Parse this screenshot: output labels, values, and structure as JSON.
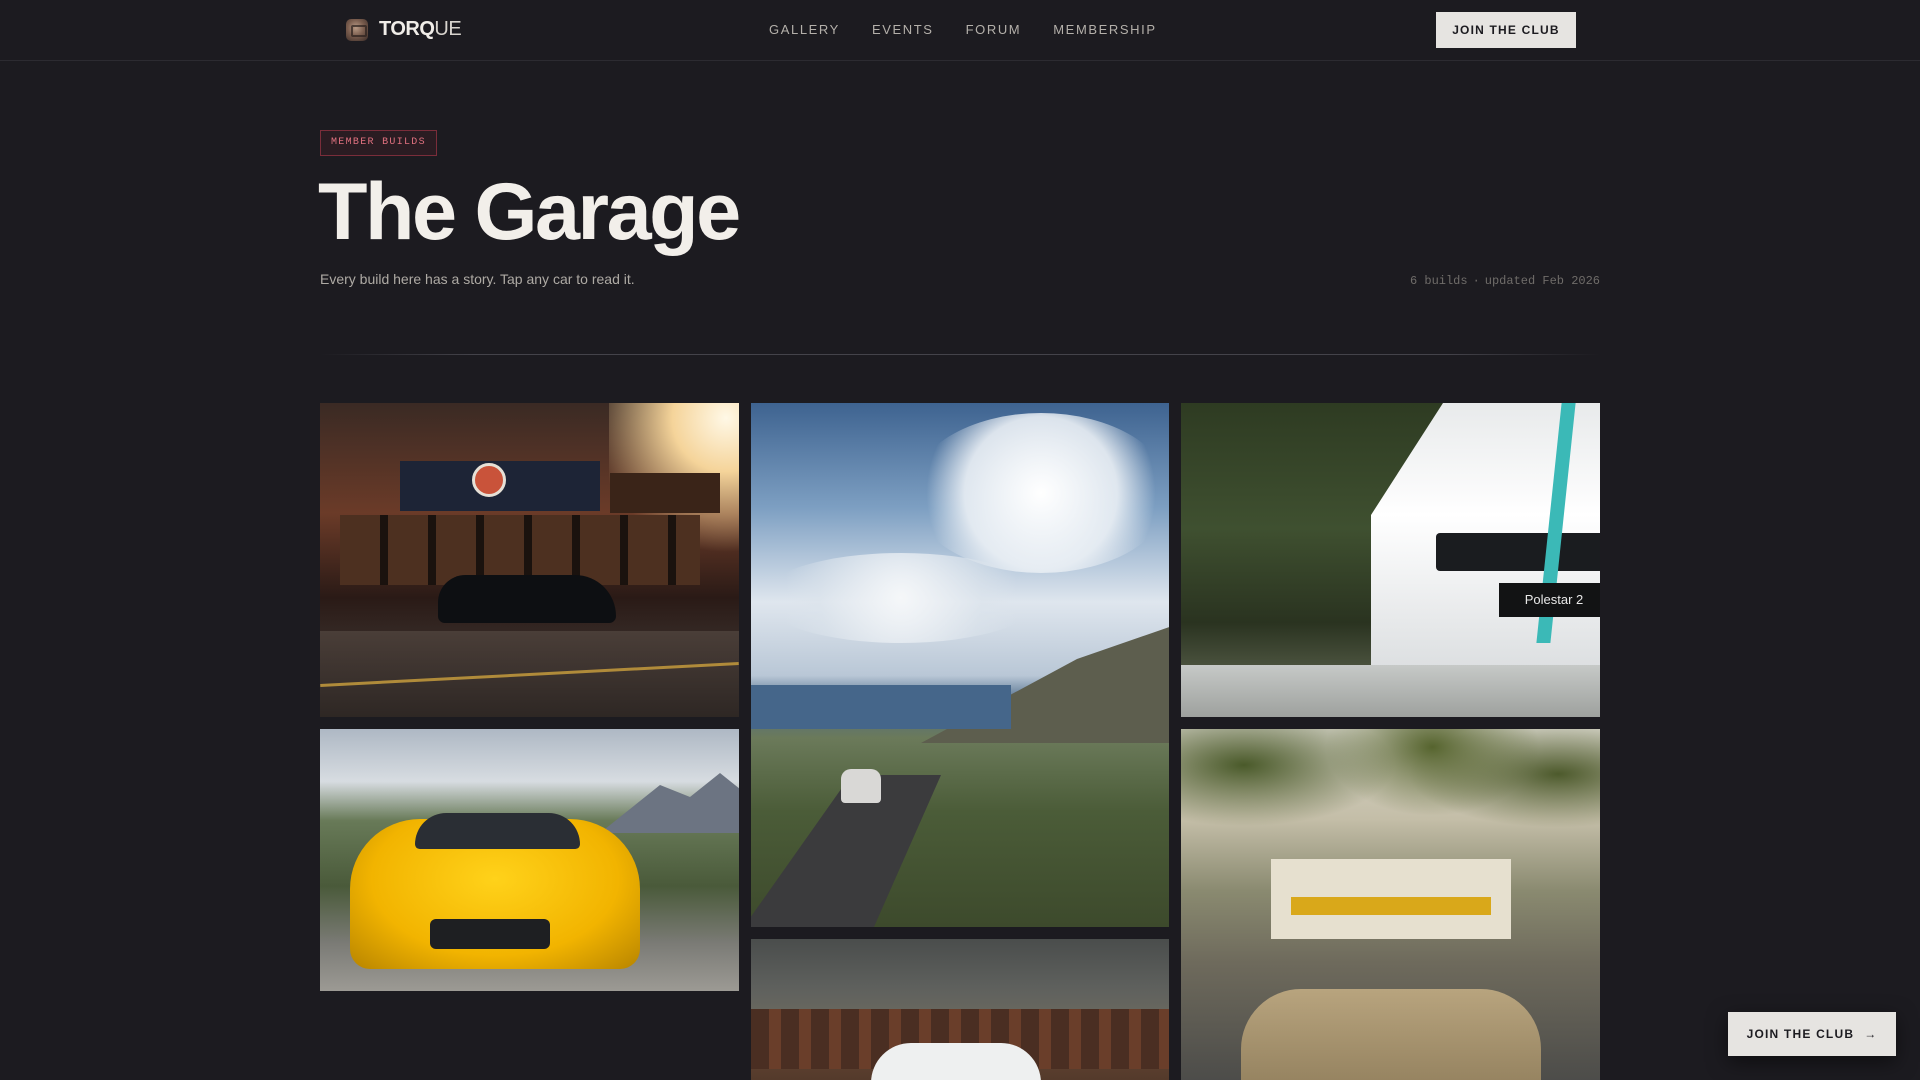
{
  "nav": {
    "brand": {
      "bold": "TORQ",
      "light": "UE",
      "logo_icon": "camera-logo-icon"
    },
    "links": [
      "GALLERY",
      "EVENTS",
      "FORUM",
      "MEMBERSHIP"
    ],
    "cta_label": "JOIN THE CLUB"
  },
  "hero": {
    "badge": "MEMBER BUILDS",
    "title": "The Garage",
    "subtitle": "Every build here has a story. Tap any car to read it.",
    "meta_count": "6 builds",
    "meta_separator": "·",
    "meta_updated": "updated Feb 2026"
  },
  "gallery": {
    "tiles": [
      {
        "id": "tile-storefront-night"
      },
      {
        "id": "tile-coastal-road"
      },
      {
        "id": "tile-polestar",
        "plate": "Polestar 2"
      },
      {
        "id": "tile-yellow-sportscar"
      },
      {
        "id": "tile-palm-street"
      },
      {
        "id": "tile-white-car-cloudy"
      }
    ]
  },
  "floating_cta": {
    "label": "JOIN THE CLUB",
    "icon": "arrow-right-icon"
  },
  "colors": {
    "background": "#1c1b20",
    "badge_text": "#e0717f",
    "badge_border": "#7a2d3a",
    "cta_bg": "#e6e4e1"
  }
}
